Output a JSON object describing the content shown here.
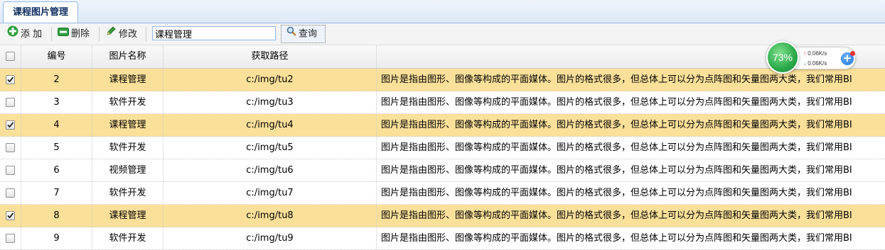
{
  "tab": {
    "label": "课程图片管理"
  },
  "toolbar": {
    "add_label": "添 加",
    "delete_label": "删除",
    "edit_label": "修改",
    "search_value": "课程管理",
    "query_label": "查询"
  },
  "grid": {
    "headers": [
      "编号",
      "图片名称",
      "获取路径",
      ""
    ],
    "rows": [
      {
        "id": "2",
        "name": "课程管理",
        "path": "c:/img/tu2",
        "desc": "图片是指由图形、图像等构成的平面媒体。图片的格式很多，但总体上可以分为点阵图和矢量图两大类，我们常用BI",
        "checked": true
      },
      {
        "id": "3",
        "name": "软件开发",
        "path": "c:/img/tu3",
        "desc": "图片是指由图形、图像等构成的平面媒体。图片的格式很多，但总体上可以分为点阵图和矢量图两大类，我们常用BI",
        "checked": false
      },
      {
        "id": "4",
        "name": "课程管理",
        "path": "c:/img/tu4",
        "desc": "图片是指由图形、图像等构成的平面媒体。图片的格式很多，但总体上可以分为点阵图和矢量图两大类，我们常用BI",
        "checked": true
      },
      {
        "id": "5",
        "name": "软件开发",
        "path": "c:/img/tu5",
        "desc": "图片是指由图形、图像等构成的平面媒体。图片的格式很多，但总体上可以分为点阵图和矢量图两大类，我们常用BI",
        "checked": false
      },
      {
        "id": "6",
        "name": "视频管理",
        "path": "c:/img/tu6",
        "desc": "图片是指由图形、图像等构成的平面媒体。图片的格式很多，但总体上可以分为点阵图和矢量图两大类，我们常用BI",
        "checked": false
      },
      {
        "id": "7",
        "name": "软件开发",
        "path": "c:/img/tu7",
        "desc": "图片是指由图形、图像等构成的平面媒体。图片的格式很多，但总体上可以分为点阵图和矢量图两大类，我们常用BI",
        "checked": false
      },
      {
        "id": "8",
        "name": "课程管理",
        "path": "c:/img/tu8",
        "desc": "图片是指由图形、图像等构成的平面媒体。图片的格式很多，但总体上可以分为点阵图和矢量图两大类，我们常用BI",
        "checked": true
      },
      {
        "id": "9",
        "name": "软件开发",
        "path": "c:/img/tu9",
        "desc": "图片是指由图形、图像等构成的平面媒体。图片的格式很多，但总体上可以分为点阵图和矢量图两大类，我们常用BI",
        "checked": false
      }
    ]
  },
  "speed_widget": {
    "percent": "73%",
    "upload": "0.06K/s",
    "download": "0.06K/s"
  },
  "colors": {
    "selected_row": "#fbe09a",
    "border_blue": "#95b8e7",
    "widget_green": "#2aa94a"
  }
}
